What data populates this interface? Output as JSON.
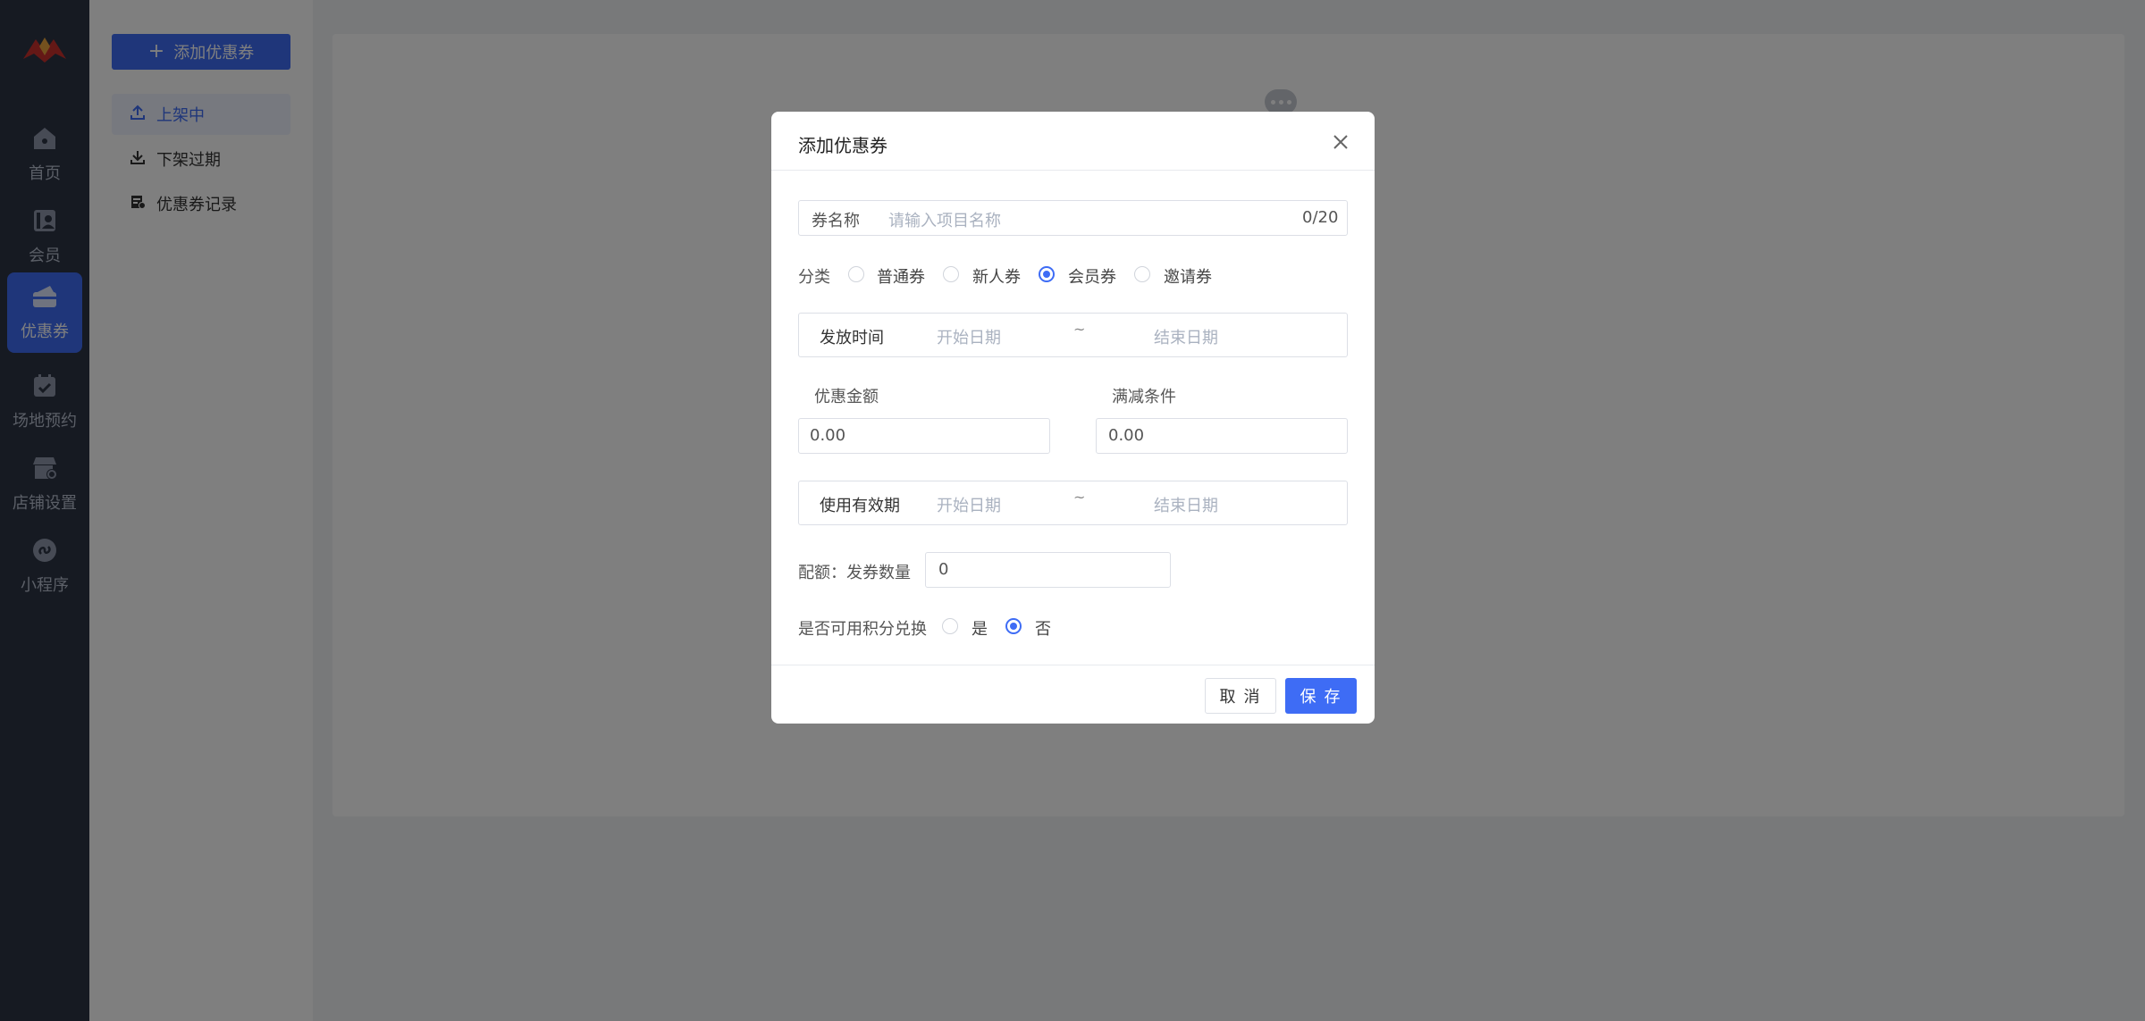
{
  "nav": {
    "items": [
      {
        "label": "首页",
        "icon": "home-icon"
      },
      {
        "label": "会员",
        "icon": "member-icon"
      },
      {
        "label": "优惠券",
        "icon": "coupon-icon"
      },
      {
        "label": "场地预约",
        "icon": "calendar-icon"
      },
      {
        "label": "店铺设置",
        "icon": "store-settings-icon"
      },
      {
        "label": "小程序",
        "icon": "mini-program-icon"
      }
    ],
    "active_index": 2
  },
  "sidebar": {
    "add_button": "添加优惠券",
    "items": [
      {
        "label": "上架中",
        "icon": "upload-icon"
      },
      {
        "label": "下架过期",
        "icon": "download-icon"
      },
      {
        "label": "优惠券记录",
        "icon": "record-icon"
      }
    ]
  },
  "modal": {
    "title": "添加优惠券",
    "name_label": "券名称",
    "name_placeholder": "请输入项目名称",
    "name_count": "0/20",
    "category_label": "分类",
    "category_options": [
      "普通券",
      "新人券",
      "会员券",
      "邀请券"
    ],
    "category_selected": "会员券",
    "issue_time_label": "发放时间",
    "start_placeholder": "开始日期",
    "range_sep": "~",
    "end_placeholder": "结束日期",
    "discount_label": "优惠金额",
    "discount_value": "0.00",
    "threshold_label": "满减条件",
    "threshold_value": "0.00",
    "valid_label": "使用有效期",
    "quota_label": "配额：发券数量",
    "quota_value": "0",
    "points_label": "是否可用积分兑换",
    "points_options": [
      "是",
      "否"
    ],
    "points_selected": "否",
    "cancel": "取 消",
    "save": "保 存"
  },
  "colors": {
    "accent": "#3e6cf5",
    "nav_bg": "#2d3445"
  }
}
